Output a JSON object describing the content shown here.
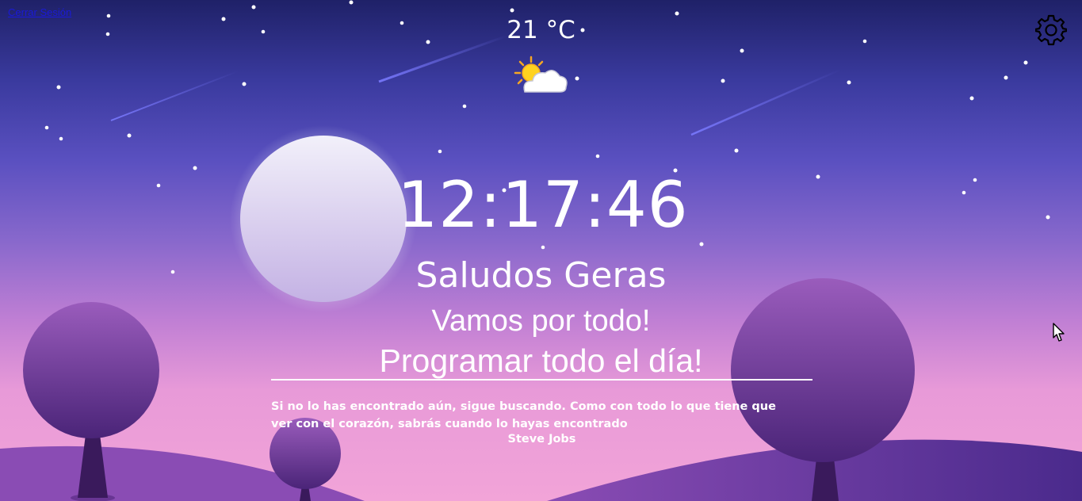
{
  "header": {
    "logout_label": "Cerrar Sesión"
  },
  "weather": {
    "temperature": "21 °C",
    "icon": "partly-cloudy-sun-icon"
  },
  "settings": {
    "icon": "gear-icon"
  },
  "main": {
    "time": "12:17:46",
    "greeting": "Saludos Geras",
    "focus_line_1": "Vamos por todo!",
    "focus_line_2": "Programar todo el día!"
  },
  "quote": {
    "text": "Si no lo has encontrado aún, sigue buscando. Como con todo lo que tiene que ver con el corazón, sabrás cuando lo hayas encontrado",
    "author": "Steve Jobs"
  },
  "colors": {
    "sky_top": "#1f2168",
    "sky_bottom": "#f2a4d8",
    "moon": "#d8d2f0",
    "tree_foliage": "#7a4aa8",
    "hills": "#6c3c9c",
    "link": "#1a1ad8"
  }
}
